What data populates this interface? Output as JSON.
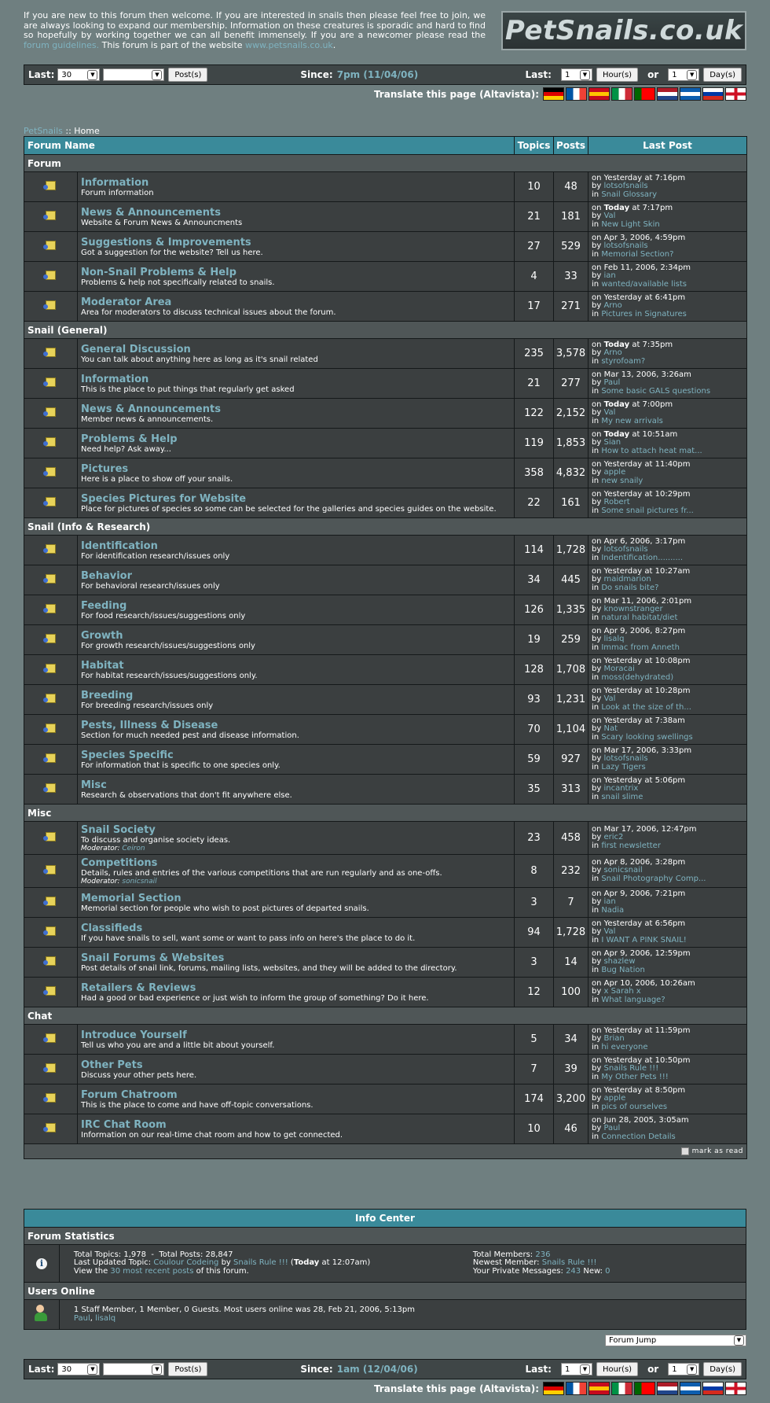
{
  "intro": {
    "text1": "If you are new to this forum then welcome. If you are interested in snails then please feel free to join, we are always looking to expand our membership. Information on these creatures is sporadic and hard to find so hopefully by working together we can all benefit immensely. If you are a newcomer please read the ",
    "guidelines_link": "forum guidelines.",
    "text2": " This forum is part of the website ",
    "website_link": "www.petsnails.co.uk",
    "text3": "."
  },
  "logo": "PetSnails.co.uk",
  "top_bar": {
    "last_label": "Last:",
    "last_value": "30",
    "period_value": "",
    "posts_button": "Post(s)",
    "since_label": "Since:",
    "since_value": "7pm (11/04/06)",
    "last2_label": "Last:",
    "hours_value": "1",
    "hours_button": "Hour(s)",
    "or_label": "or",
    "days_value": "1",
    "days_button": "Day(s)"
  },
  "bottom_bar": {
    "last_label": "Last:",
    "last_value": "30",
    "period_value": "",
    "posts_button": "Post(s)",
    "since_label": "Since:",
    "since_value": "1am (12/04/06)",
    "last2_label": "Last:",
    "hours_value": "1",
    "hours_button": "Hour(s)",
    "or_label": "or",
    "days_value": "1",
    "days_button": "Day(s)"
  },
  "translate": {
    "label": "Translate this page (Altavista):",
    "flags": [
      {
        "name": "german-flag",
        "colors": [
          "#000000",
          "#dd0000",
          "#ffce00"
        ],
        "dir": "h"
      },
      {
        "name": "french-flag",
        "colors": [
          "#0055a4",
          "#ffffff",
          "#ef4135"
        ],
        "dir": "v"
      },
      {
        "name": "spanish-flag",
        "colors": [
          "#c60b1e",
          "#ffc400",
          "#c60b1e"
        ],
        "dir": "h"
      },
      {
        "name": "italian-flag",
        "colors": [
          "#009246",
          "#ffffff",
          "#ce2b37"
        ],
        "dir": "v"
      },
      {
        "name": "portuguese-flag",
        "colors": [
          "#006600",
          "#ff0000",
          "#ff0000"
        ],
        "dir": "v"
      },
      {
        "name": "dutch-flag",
        "colors": [
          "#ae1c28",
          "#ffffff",
          "#21468b"
        ],
        "dir": "h"
      },
      {
        "name": "greek-flag",
        "colors": [
          "#0d5eaf",
          "#ffffff",
          "#0d5eaf"
        ],
        "dir": "h"
      },
      {
        "name": "russian-flag",
        "colors": [
          "#ffffff",
          "#0039a6",
          "#d52b1e"
        ],
        "dir": "h"
      },
      {
        "name": "english-flag",
        "colors": [
          "#ffffff",
          "#ce1124",
          "#ffffff"
        ],
        "dir": "cross"
      }
    ]
  },
  "breadcrumb": {
    "root": "PetSnails",
    "sep": " :: ",
    "current": "Home"
  },
  "headers": {
    "name": "Forum Name",
    "topics": "Topics",
    "posts": "Posts",
    "last_post": "Last Post"
  },
  "categories": [
    {
      "name": "Forum",
      "forums": [
        {
          "name": "Information",
          "desc": "Forum information",
          "topics": "10",
          "posts": "48",
          "when": "on Yesterday at 7:16pm",
          "by": "lotsofsnails",
          "in": "Snail Glossary"
        },
        {
          "name": "News & Announcements",
          "desc": "Website & Forum News & Announcments",
          "topics": "21",
          "posts": "181",
          "when_bold": "Today",
          "when_pre": "on ",
          "when_post": " at 7:17pm",
          "by": "Val",
          "in": "New Light Skin"
        },
        {
          "name": "Suggestions & Improvements",
          "desc": "Got a suggestion for the website? Tell us here.",
          "topics": "27",
          "posts": "529",
          "when": "on Apr 3, 2006, 4:59pm",
          "by": "lotsofsnails",
          "in": "Memorial Section?"
        },
        {
          "name": "Non-Snail Problems & Help",
          "desc": "Problems & help not specifically related to snails.",
          "topics": "4",
          "posts": "33",
          "when": "on Feb 11, 2006, 2:34pm",
          "by": "ian",
          "in": "wanted/available lists"
        },
        {
          "name": "Moderator Area",
          "desc": "Area for moderators to discuss technical issues about the forum.",
          "topics": "17",
          "posts": "271",
          "when": "on Yesterday at 6:41pm",
          "by": "Arno",
          "in": "Pictures in Signatures"
        }
      ]
    },
    {
      "name": "Snail (General)",
      "forums": [
        {
          "name": "General Discussion",
          "desc": "You can talk about anything here as long as it's snail related",
          "topics": "235",
          "posts": "3,578",
          "when_bold": "Today",
          "when_pre": "on ",
          "when_post": " at 7:35pm",
          "by": "Arno",
          "in": "styrofoam?"
        },
        {
          "name": "Information",
          "desc": "This is the place to put things that regularly get asked",
          "topics": "21",
          "posts": "277",
          "when": "on Mar 13, 2006, 3:26am",
          "by": "Paul",
          "in": "Some basic GALS questions"
        },
        {
          "name": "News & Announcements",
          "desc": "Member news & announcements.",
          "topics": "122",
          "posts": "2,152",
          "when_bold": "Today",
          "when_pre": "on ",
          "when_post": " at 7:00pm",
          "by": "Val",
          "in": "My new arrivals"
        },
        {
          "name": "Problems & Help",
          "desc": "Need help? Ask away...",
          "topics": "119",
          "posts": "1,853",
          "when_bold": "Today",
          "when_pre": "on ",
          "when_post": " at 10:51am",
          "by": "Sian",
          "in": "How to attach heat mat..."
        },
        {
          "name": "Pictures",
          "desc": "Here is a place to show off your snails.",
          "topics": "358",
          "posts": "4,832",
          "when": "on Yesterday at 11:40pm",
          "by": "apple",
          "in": "new snaily"
        },
        {
          "name": "Species Pictures for Website",
          "desc": "Place for pictures of species so some can be selected for the galleries and species guides on the website.",
          "topics": "22",
          "posts": "161",
          "when": "on Yesterday at 10:29pm",
          "by": "Robert",
          "in": "Some snail pictures fr..."
        }
      ]
    },
    {
      "name": "Snail (Info & Research)",
      "forums": [
        {
          "name": "Identification",
          "desc": "For identification research/issues only",
          "topics": "114",
          "posts": "1,728",
          "when": "on Apr 6, 2006, 3:17pm",
          "by": "lotsofsnails",
          "in": "Indentification.........."
        },
        {
          "name": "Behavior",
          "desc": "For behavioral research/issues only",
          "topics": "34",
          "posts": "445",
          "when": "on Yesterday at 10:27am",
          "by": "maidmarion",
          "in": "Do snails bite?"
        },
        {
          "name": "Feeding",
          "desc": "For food research/issues/suggestions only",
          "topics": "126",
          "posts": "1,335",
          "when": "on Mar 11, 2006, 2:01pm",
          "by": "knownstranger",
          "in": "natural habitat/diet"
        },
        {
          "name": "Growth",
          "desc": "For growth research/issues/suggestions only",
          "topics": "19",
          "posts": "259",
          "when": "on Apr 9, 2006, 8:27pm",
          "by": "lisalq",
          "in": "Immac from Anneth"
        },
        {
          "name": "Habitat",
          "desc": "For habitat research/issues/suggestions only.",
          "topics": "128",
          "posts": "1,708",
          "when": "on Yesterday at 10:08pm",
          "by": "Moracai",
          "in": "moss(dehydrated)"
        },
        {
          "name": "Breeding",
          "desc": "For breeding research/issues only",
          "topics": "93",
          "posts": "1,231",
          "when": "on Yesterday at 10:28pm",
          "by": "Val",
          "in": "Look at the size of th..."
        },
        {
          "name": "Pests, Illness & Disease",
          "desc": "Section for much needed pest and disease information.",
          "topics": "70",
          "posts": "1,104",
          "when": "on Yesterday at 7:38am",
          "by": "Nat",
          "in": "Scary looking swellings"
        },
        {
          "name": "Species Specific",
          "desc": "For information that is specific to one species only.",
          "topics": "59",
          "posts": "927",
          "when": "on Mar 17, 2006, 3:33pm",
          "by": "lotsofsnails",
          "in": "Lazy Tigers"
        },
        {
          "name": "Misc",
          "desc": "Research & observations that don't fit anywhere else.",
          "topics": "35",
          "posts": "313",
          "when": "on Yesterday at 5:06pm",
          "by": "incantrix",
          "in": "snail slime"
        }
      ]
    },
    {
      "name": "Misc",
      "forums": [
        {
          "name": "Snail Society",
          "desc": "To discuss and organise society ideas.",
          "mod_label": "Moderator:",
          "mod": "Ceiron",
          "topics": "23",
          "posts": "458",
          "when": "on Mar 17, 2006, 12:47pm",
          "by": "eric2",
          "in": "first newsletter"
        },
        {
          "name": "Competitions",
          "desc": "Details, rules and entries of the various competitions that are run regularly and as one-offs.",
          "mod_label": "Moderator:",
          "mod": "sonicsnail",
          "topics": "8",
          "posts": "232",
          "when": "on Apr 8, 2006, 3:28pm",
          "by": "sonicsnail",
          "in": "Snail Photography Comp..."
        },
        {
          "name": "Memorial Section",
          "desc": "Memorial section for people who wish to post pictures of departed snails.",
          "topics": "3",
          "posts": "7",
          "when": "on Apr 9, 2006, 7:21pm",
          "by": "ian",
          "in": "Nadia"
        },
        {
          "name": "Classifieds",
          "desc": "If you have snails to sell, want some or want to pass info on here's the place to do it.",
          "topics": "94",
          "posts": "1,728",
          "when": "on Yesterday at 6:56pm",
          "by": "Val",
          "in": "I WANT A PINK SNAIL!"
        },
        {
          "name": "Snail Forums & Websites",
          "desc": "Post details of snail link, forums, mailing lists, websites, and they will be added to the directory.",
          "topics": "3",
          "posts": "14",
          "when": "on Apr 9, 2006, 12:59pm",
          "by": "shazlew",
          "in": "Bug Nation"
        },
        {
          "name": "Retailers & Reviews",
          "desc": "Had a good or bad experience or just wish to inform the group of something? Do it here.",
          "topics": "12",
          "posts": "100",
          "when": "on Apr 10, 2006, 10:26am",
          "by": "x Sarah x",
          "in": "What language?"
        }
      ]
    },
    {
      "name": "Chat",
      "forums": [
        {
          "name": "Introduce Yourself",
          "desc": "Tell us who you are and a little bit about yourself.",
          "topics": "5",
          "posts": "34",
          "when": "on Yesterday at 11:59pm",
          "by": "Brian",
          "in": "hi everyone"
        },
        {
          "name": "Other Pets",
          "desc": "Discuss your other pets here.",
          "topics": "7",
          "posts": "39",
          "when": "on Yesterday at 10:50pm",
          "by": "Snails Rule !!!",
          "in": "My Other Pets !!!"
        },
        {
          "name": "Forum Chatroom",
          "desc": "This is the place to come and have off-topic conversations.",
          "topics": "174",
          "posts": "3,200",
          "when": "on Yesterday at 8:50pm",
          "by": "apple",
          "in": "pics of ourselves"
        },
        {
          "name": "IRC Chat Room",
          "desc": "Information on our real-time chat room and how to get connected.",
          "topics": "10",
          "posts": "46",
          "when": "on Jun 28, 2005, 3:05am",
          "by": "Paul",
          "in": "Connection Details"
        }
      ]
    }
  ],
  "labels": {
    "by": "by ",
    "in": "in "
  },
  "mark_as_read": "mark as read",
  "info_center": {
    "title": "Info Center",
    "stats_title": "Forum Statistics",
    "total_topics": "Total Topics: 1,978",
    "total_posts": "Total Posts: 28,847",
    "last_updated_label": "Last Updated Topic: ",
    "last_updated_topic": "Coulour Codeing",
    "last_updated_by": " by ",
    "last_updated_user": "Snails Rule !!!",
    "last_updated_when_bold": "Today",
    "last_updated_when": " at 12:07am)",
    "view_pre": "View the ",
    "view_link": "30 most recent posts",
    "view_post": " of this forum.",
    "total_members_label": "Total Members: ",
    "total_members": "236",
    "newest_label": "Newest Member: ",
    "newest": "Snails Rule !!!",
    "pm_label": "Your Private Messages: ",
    "pm_count": "243",
    "new_label": " New: ",
    "new_count": "0",
    "users_title": "Users Online",
    "users_text": "1 Staff Member, 1 Member, 0 Guests. Most users online was 28, Feb 21, 2006, 5:13pm",
    "user1": "Paul",
    "user2": "lisalq"
  },
  "forum_jump": "Forum Jump"
}
